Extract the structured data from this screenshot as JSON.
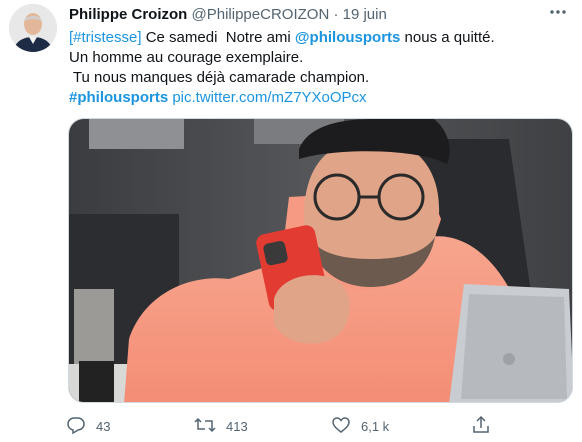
{
  "tweet": {
    "author_name": "Philippe Croizon",
    "author_handle": "@PhilippeCROIZON",
    "separator": "·",
    "date": "19 juin",
    "text": {
      "line1_hashtag": "[#tristesse]",
      "line1_middle": " Ce samedi  Notre ami ",
      "line1_mention": "@philousports",
      "line1_end": " nous a quitté.",
      "line2": "Un homme au courage exemplaire.",
      "line3": " Tu nous manques déjà camarade champion.",
      "line4_hashtag": "#philousports",
      "line4_link": "pic.twitter.com/mZ7YXoOPcx"
    }
  },
  "actions": {
    "reply_count": "43",
    "retweet_count": "413",
    "like_count": "6,1 k"
  },
  "icons": {
    "more": "more-options-icon",
    "reply": "reply-icon",
    "retweet": "retweet-icon",
    "like": "heart-icon",
    "share": "share-icon"
  },
  "colors": {
    "link": "#1b95e0",
    "text": "#0f1419",
    "muted": "#536471"
  }
}
